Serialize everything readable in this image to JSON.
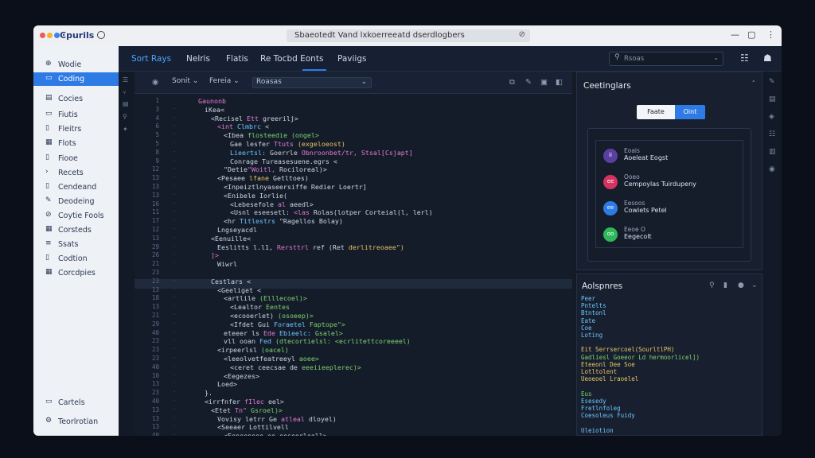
{
  "window": {
    "app_name": "Ͼpurils",
    "address": "Sbaeotedt Vand lxkoerreeatd dserdlogbers"
  },
  "sidebar": {
    "items": [
      {
        "label": "Wodie",
        "icon": "globe-icon"
      },
      {
        "label": "Coding",
        "icon": "code-icon",
        "active": true
      },
      {
        "label": "Cocies",
        "icon": "file-icon"
      },
      {
        "label": "Fiutis",
        "icon": "folder-icon"
      },
      {
        "label": "Fleitrs",
        "icon": "page-icon"
      },
      {
        "label": "Flots",
        "icon": "grid-icon"
      },
      {
        "label": "Fiooe",
        "icon": "page-icon"
      },
      {
        "label": "Recets",
        "icon": "chevron-right-icon"
      },
      {
        "label": "Cendeand",
        "icon": "bookmark-icon"
      },
      {
        "label": "Deodeing",
        "icon": "pencil-icon"
      },
      {
        "label": "Coytie Fools",
        "icon": "link-icon"
      },
      {
        "label": "Corsteds",
        "icon": "grid-icon"
      },
      {
        "label": "Ssats",
        "icon": "list-icon"
      },
      {
        "label": "Codtion",
        "icon": "page-icon"
      },
      {
        "label": "Corcdpies",
        "icon": "grid-icon"
      }
    ],
    "bottom_items": [
      {
        "label": "Cartels",
        "icon": "folder-icon"
      },
      {
        "label": "Teorlrotian",
        "icon": "gear-icon"
      }
    ]
  },
  "topnav": {
    "tabs": [
      "Sort Rays",
      "Nelris",
      "Flatis",
      "Re Tocbd Eonts",
      "Paviigs"
    ],
    "search_placeholder": "Rsoas"
  },
  "editor_toolbar": {
    "dropdown1": "Sonit",
    "dropdown2": "Fereia",
    "dropdown3": "Roasas"
  },
  "code": {
    "line_numbers": [
      "1",
      "3",
      "4",
      "6",
      "5",
      "5",
      "8",
      "9",
      "12",
      "13",
      "13",
      "13",
      "16",
      "11",
      "17",
      "12",
      "13",
      "29",
      "26",
      "21",
      "23",
      "23",
      "13",
      "18",
      "13",
      "21",
      "29",
      "40",
      "23",
      "23",
      "23",
      "40",
      "10",
      "13",
      "23",
      "40",
      "13",
      "13",
      "13",
      "40",
      "10",
      "23",
      "13",
      "23"
    ],
    "lines": [
      {
        "indent": 0,
        "segs": [
          {
            "t": "Gaunonb",
            "c": "#e47bd0"
          }
        ]
      },
      {
        "indent": 1,
        "segs": [
          {
            "t": "iKea<",
            "c": "#cfd6e2"
          }
        ]
      },
      {
        "indent": 2,
        "segs": [
          {
            "t": "<Recisel",
            "c": "#cfd6e2"
          },
          {
            "t": " Ett ",
            "c": "#e47bd0"
          },
          {
            "t": "greerilj>",
            "c": "#cfd6e2"
          }
        ]
      },
      {
        "indent": 3,
        "segs": [
          {
            "t": "<int ",
            "c": "#e47bd0"
          },
          {
            "t": "Clmbrc ",
            "c": "#6cc4ff"
          },
          {
            "t": "<",
            "c": "#cfd6e2"
          }
        ]
      },
      {
        "indent": 4,
        "segs": [
          {
            "t": "<Ibea ",
            "c": "#cfd6e2"
          },
          {
            "t": "flosteedie ",
            "c": "#7fd36c"
          },
          {
            "t": "(ongel>",
            "c": "#7fd36c"
          }
        ]
      },
      {
        "indent": 5,
        "segs": [
          {
            "t": "Gae ",
            "c": "#cfd6e2"
          },
          {
            "t": "lesfer ",
            "c": "#cfd6e2"
          },
          {
            "t": "Ttuts ",
            "c": "#e47bd0"
          },
          {
            "t": "(exgeloeost)",
            "c": "#e7c463"
          }
        ]
      },
      {
        "indent": 5,
        "segs": [
          {
            "t": "Lieertsl: ",
            "c": "#6cc4ff"
          },
          {
            "t": "Goerrle ",
            "c": "#cfd6e2"
          },
          {
            "t": "Obnroonbet/tr, ",
            "c": "#e47bd0"
          },
          {
            "t": "Stsal[Csjapt]",
            "c": "#e47bd0"
          }
        ]
      },
      {
        "indent": 5,
        "segs": [
          {
            "t": "Conrage ",
            "c": "#cfd6e2"
          },
          {
            "t": "Tureasesuene.egrs ",
            "c": "#cfd6e2"
          },
          {
            "t": "<",
            "c": "#cfd6e2"
          }
        ]
      },
      {
        "indent": 4,
        "segs": [
          {
            "t": "\"Detie",
            "c": "#cfd6e2"
          },
          {
            "t": "\"Woitl, ",
            "c": "#e47bd0"
          },
          {
            "t": "Rociloreal)>",
            "c": "#cfd6e2"
          }
        ]
      },
      {
        "indent": 3,
        "segs": [
          {
            "t": "<Pesaee ",
            "c": "#cfd6e2"
          },
          {
            "t": "lfane ",
            "c": "#e7c463"
          },
          {
            "t": "Getltoes) ",
            "c": "#cfd6e2"
          }
        ]
      },
      {
        "indent": 4,
        "segs": [
          {
            "t": "<Inpeiztlnyaseersiffe ",
            "c": "#cfd6e2"
          },
          {
            "t": "Redier ",
            "c": "#cfd6e2"
          },
          {
            "t": "Loertr]",
            "c": "#cfd6e2"
          }
        ]
      },
      {
        "indent": 4,
        "segs": [
          {
            "t": "<Enibele ",
            "c": "#cfd6e2"
          },
          {
            "t": "Iorlie(",
            "c": "#cfd6e2"
          }
        ]
      },
      {
        "indent": 5,
        "segs": [
          {
            "t": "<Lebesefole ",
            "c": "#cfd6e2"
          },
          {
            "t": "al ",
            "c": "#e47bd0"
          },
          {
            "t": "aeedl>",
            "c": "#cfd6e2"
          }
        ]
      },
      {
        "indent": 5,
        "segs": [
          {
            "t": "<Usnl ",
            "c": "#cfd6e2"
          },
          {
            "t": "eseesetl: ",
            "c": "#cfd6e2"
          },
          {
            "t": "<las ",
            "c": "#e47bd0"
          },
          {
            "t": "Rolas(lotper ",
            "c": "#cfd6e2"
          },
          {
            "t": "Corteial(l, ",
            "c": "#cfd6e2"
          },
          {
            "t": "lerl)",
            "c": "#cfd6e2"
          }
        ]
      },
      {
        "indent": 4,
        "segs": [
          {
            "t": "<hr ",
            "c": "#cfd6e2"
          },
          {
            "t": "Titlestrs ",
            "c": "#6cc4ff"
          },
          {
            "t": "\"Ragellos ",
            "c": "#cfd6e2"
          },
          {
            "t": "Bolay)",
            "c": "#cfd6e2"
          }
        ]
      },
      {
        "indent": 3,
        "segs": [
          {
            "t": "Lngseyacdl",
            "c": "#cfd6e2"
          }
        ]
      },
      {
        "indent": 2,
        "segs": [
          {
            "t": "<Eenuille<",
            "c": "#cfd6e2"
          }
        ]
      },
      {
        "indent": 3,
        "segs": [
          {
            "t": "Eeslitts ",
            "c": "#cfd6e2"
          },
          {
            "t": "l.l1, ",
            "c": "#cfd6e2"
          },
          {
            "t": "Rersttrl ",
            "c": "#e47bd0"
          },
          {
            "t": "ref ",
            "c": "#cfd6e2"
          },
          {
            "t": "(Ret ",
            "c": "#cfd6e2"
          },
          {
            "t": "derlitreoaee\")",
            "c": "#e7c463"
          }
        ]
      },
      {
        "indent": 2,
        "segs": [
          {
            "t": "]>",
            "c": "#e47bd0"
          }
        ]
      },
      {
        "indent": 3,
        "segs": [
          {
            "t": "Wiwrl",
            "c": "#cfd6e2"
          }
        ],
        "highlight": true
      },
      {
        "indent": 0,
        "segs": [
          {
            "t": "",
            "c": "#cfd6e2"
          }
        ]
      },
      {
        "indent": 2,
        "segs": [
          {
            "t": "Cestlars ",
            "c": "#cfd6e2"
          },
          {
            "t": "<",
            "c": "#cfd6e2"
          }
        ]
      },
      {
        "indent": 3,
        "segs": [
          {
            "t": "<Geeliget ",
            "c": "#cfd6e2"
          },
          {
            "t": "<",
            "c": "#cfd6e2"
          }
        ]
      },
      {
        "indent": 4,
        "segs": [
          {
            "t": "<artlile ",
            "c": "#cfd6e2"
          },
          {
            "t": "(Elllecoel)>",
            "c": "#7fd36c"
          }
        ]
      },
      {
        "indent": 5,
        "segs": [
          {
            "t": "<Lealtor ",
            "c": "#cfd6e2"
          },
          {
            "t": "Eentes",
            "c": "#7fd36c"
          }
        ]
      },
      {
        "indent": 5,
        "segs": [
          {
            "t": "<ecooerlet) ",
            "c": "#cfd6e2"
          },
          {
            "t": "(osoeep)>",
            "c": "#7fd36c"
          }
        ]
      },
      {
        "indent": 5,
        "segs": [
          {
            "t": "<Ifdet ",
            "c": "#cfd6e2"
          },
          {
            "t": "Gui ",
            "c": "#cfd6e2"
          },
          {
            "t": "Foraetel ",
            "c": "#6cc4ff"
          },
          {
            "t": "Faptope\">",
            "c": "#7fd36c"
          }
        ]
      },
      {
        "indent": 4,
        "segs": [
          {
            "t": "eteeer ",
            "c": "#cfd6e2"
          },
          {
            "t": "ls ",
            "c": "#cfd6e2"
          },
          {
            "t": "Ede ",
            "c": "#e47bd0"
          },
          {
            "t": "Ebieelc: ",
            "c": "#6cc4ff"
          },
          {
            "t": "Gsalel>",
            "c": "#7fd36c"
          }
        ]
      },
      {
        "indent": 4,
        "segs": [
          {
            "t": "vll ",
            "c": "#cfd6e2"
          },
          {
            "t": "ooan ",
            "c": "#cfd6e2"
          },
          {
            "t": "Fed ",
            "c": "#6cc4ff"
          },
          {
            "t": "(dtecortielsl: ",
            "c": "#7fd36c"
          },
          {
            "t": "<ecrlitettcoreeeel)",
            "c": "#7fd36c"
          }
        ]
      },
      {
        "indent": 3,
        "segs": [
          {
            "t": "<irpeerlsl ",
            "c": "#cfd6e2"
          },
          {
            "t": "(oacel)",
            "c": "#7fd36c"
          }
        ]
      },
      {
        "indent": 4,
        "segs": [
          {
            "t": "<leeolvetfeatreeyl ",
            "c": "#cfd6e2"
          },
          {
            "t": "aoee>",
            "c": "#7fd36c"
          }
        ]
      },
      {
        "indent": 5,
        "segs": [
          {
            "t": "<ceret ",
            "c": "#cfd6e2"
          },
          {
            "t": "ceecsae ",
            "c": "#cfd6e2"
          },
          {
            "t": "de ",
            "c": "#cfd6e2"
          },
          {
            "t": "eeeiieeplerec)>",
            "c": "#7fd36c"
          }
        ]
      },
      {
        "indent": 4,
        "segs": [
          {
            "t": "<Eegezes>",
            "c": "#cfd6e2"
          }
        ]
      },
      {
        "indent": 3,
        "segs": [
          {
            "t": "Loed>",
            "c": "#cfd6e2"
          }
        ]
      },
      {
        "indent": 1,
        "segs": [
          {
            "t": "}.",
            "c": "#cfd6e2"
          }
        ]
      },
      {
        "indent": 1,
        "segs": [
          {
            "t": "<irrfnfer ",
            "c": "#cfd6e2"
          },
          {
            "t": "fIlec ",
            "c": "#e47bd0"
          },
          {
            "t": "eel>",
            "c": "#cfd6e2"
          }
        ]
      },
      {
        "indent": 2,
        "segs": [
          {
            "t": "<Etet ",
            "c": "#cfd6e2"
          },
          {
            "t": "Tn\" ",
            "c": "#e47bd0"
          },
          {
            "t": "Gsroel)>",
            "c": "#7fd36c"
          }
        ]
      },
      {
        "indent": 3,
        "segs": [
          {
            "t": "Vovisy ",
            "c": "#cfd6e2"
          },
          {
            "t": "letrr ",
            "c": "#cfd6e2"
          },
          {
            "t": "Ge ",
            "c": "#cfd6e2"
          },
          {
            "t": "atleal ",
            "c": "#e47bd0"
          },
          {
            "t": "dloyel)",
            "c": "#cfd6e2"
          }
        ]
      },
      {
        "indent": 3,
        "segs": [
          {
            "t": "<Seeaer ",
            "c": "#cfd6e2"
          },
          {
            "t": "Lottilvell ",
            "c": "#cfd6e2"
          }
        ]
      },
      {
        "indent": 4,
        "segs": [
          {
            "t": "<Eeneeneee ",
            "c": "#cfd6e2"
          },
          {
            "t": "oe ",
            "c": "#cfd6e2"
          },
          {
            "t": "eeseerleell>",
            "c": "#cfd6e2"
          }
        ]
      },
      {
        "indent": 4,
        "segs": [
          {
            "t": "<eer ",
            "c": "#cfd6e2"
          },
          {
            "t": "ifr ",
            "c": "#cfd6e2"
          },
          {
            "t": "leseel]>",
            "c": "#cfd6e2"
          }
        ]
      },
      {
        "indent": 3,
        "segs": [
          {
            "t": "<Beee ",
            "c": "#cfd6e2"
          },
          {
            "t": "far ",
            "c": "#cfd6e2"
          },
          {
            "t": "Ifeeesl)>",
            "c": "#cfd6e2"
          }
        ]
      }
    ]
  },
  "panel_right": {
    "title": "Ceetinglars",
    "toggle": [
      "Faate",
      "Oint"
    ],
    "items": [
      {
        "small": "Eoais",
        "main": "Aoeleat Eogst",
        "color": "#5b3fa0",
        "icon": "ii"
      },
      {
        "small": "Ooeo",
        "main": "Cempoylas Tuirdupeny",
        "color": "#d6325f",
        "icon": "ee"
      },
      {
        "small": "Eesoos",
        "main": "Cowlets Petel",
        "color": "#2f7be6",
        "icon": "ee"
      },
      {
        "small": "Eeoe O",
        "main": "Eegecolt",
        "color": "#2fb85a",
        "icon": "oo"
      }
    ]
  },
  "panel_console": {
    "title": "Aolspnres",
    "lines": [
      {
        "t": "Peer",
        "c": "#6cc4ff"
      },
      {
        "t": "Pntelts",
        "c": "#6cc4ff"
      },
      {
        "t": "Btntonl",
        "c": "#6cc4ff"
      },
      {
        "t": "Eate",
        "c": "#6cc4ff"
      },
      {
        "t": "Coe",
        "c": "#6cc4ff"
      },
      {
        "t": "Loting",
        "c": "#6cc4ff"
      },
      {
        "t": "",
        "c": "#6cc4ff"
      },
      {
        "t": "Eit Serrsercoel(SourltlPH)",
        "c": "#e7c463"
      },
      {
        "t": "Gadliesl Goeeor Ld hermoorlicel])",
        "c": "#7fd36c"
      },
      {
        "t": "Eteeonl Dee Soe",
        "c": "#e7c463"
      },
      {
        "t": "Lotltolent",
        "c": "#e7c463"
      },
      {
        "t": "Ueoeoel Lraoelel",
        "c": "#e7c463"
      },
      {
        "t": "",
        "c": "#6cc4ff"
      },
      {
        "t": "Eus",
        "c": "#7fd36c"
      },
      {
        "t": "Esesedy",
        "c": "#6cc4ff"
      },
      {
        "t": "Fretlnfoleg",
        "c": "#6cc4ff"
      },
      {
        "t": "Coesoleus Fuidy",
        "c": "#6cc4ff"
      },
      {
        "t": "",
        "c": "#6cc4ff"
      },
      {
        "t": "Uleiotion",
        "c": "#6cc4ff"
      }
    ]
  },
  "colors": {
    "accent": "#2f7be6",
    "bg": "#141b27"
  }
}
